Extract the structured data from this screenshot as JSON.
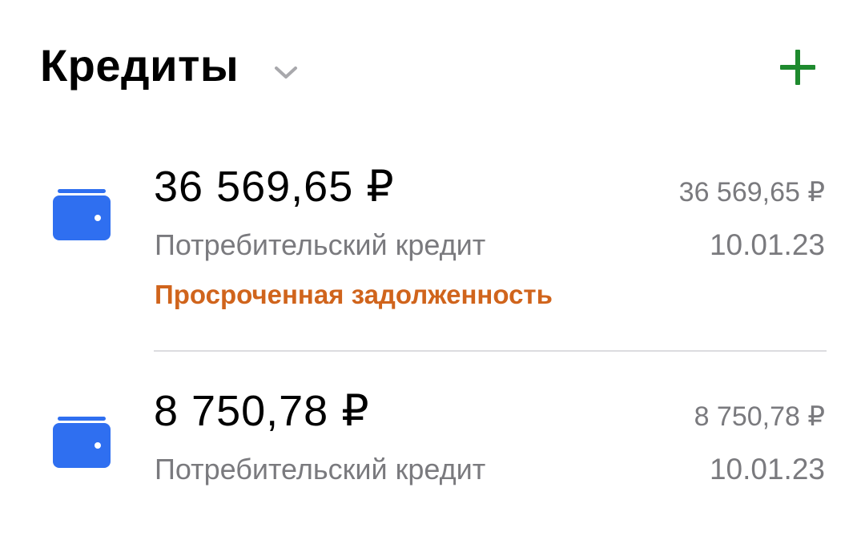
{
  "header": {
    "title": "Кредиты",
    "expand_icon": "chevron-down-icon",
    "add_icon": "plus-icon",
    "accent_color": "#1e8a2e"
  },
  "credits": [
    {
      "amount": "36 569,65 ₽",
      "type": "Потребительский кредит",
      "status": "Просроченная задолженность",
      "side_amount": "36 569,65 ₽",
      "date": "10.01.23",
      "icon": "wallet-icon",
      "icon_color": "#2f6ff0",
      "status_color": "#d0641c"
    },
    {
      "amount": "8 750,78 ₽",
      "type": "Потребительский кредит",
      "side_amount": "8 750,78 ₽",
      "date": "10.01.23",
      "icon": "wallet-icon",
      "icon_color": "#2f6ff0"
    }
  ]
}
